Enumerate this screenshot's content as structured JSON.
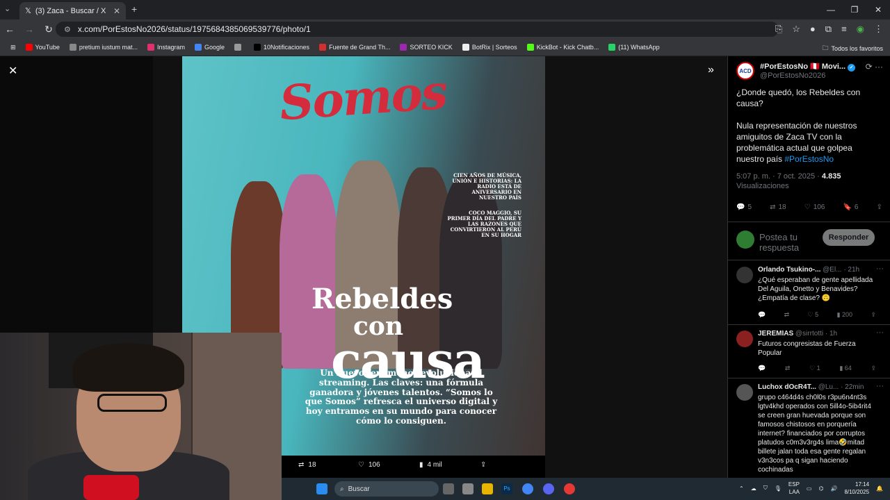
{
  "browser": {
    "tab_title": "(3) Zaca - Buscar / X",
    "url": "x.com/PorEstosNo2026/status/1975684385069539776/photo/1",
    "bookmarks": [
      {
        "label": "YouTube",
        "color": "#ff0000"
      },
      {
        "label": "pretium iustum mat...",
        "color": "#888888"
      },
      {
        "label": "Instagram",
        "color": "#e1306c"
      },
      {
        "label": "Google",
        "color": "#4285f4"
      },
      {
        "label": "",
        "color": "#999999"
      },
      {
        "label": "10Notificaciones",
        "color": "#000000"
      },
      {
        "label": "Fuente de Grand Th...",
        "color": "#d32f2f"
      },
      {
        "label": "SORTEO KICK",
        "color": "#9c27b0"
      },
      {
        "label": "BotRix | Sorteos",
        "color": "#eeeeee"
      },
      {
        "label": "KickBot - Kick Chatb...",
        "color": "#53fc18"
      },
      {
        "label": "(11) WhatsApp",
        "color": "#25d366"
      }
    ],
    "all_bookmarks": "Todos los favoritos"
  },
  "magazine": {
    "masthead": "Somos",
    "side_text_1": "Cien años de música, unión e historias: La radio está de aniversario en nuestro país",
    "side_text_2": "Coco Maggio, su primer día del padre y las razones que convirtieron al Perú en su hogar",
    "headline_1": "Rebeldes",
    "headline_2": "con",
    "headline_3": "causa",
    "description": "Un nuevo fenómeno revoluciona el streaming. Las claves: una fórmula ganadora y jóvenes talentos. “Somos lo que Somos” refresca el universo digital y hoy entramos en su mundo para conocer cómo lo consiguen."
  },
  "photo_actions": {
    "retweets": "18",
    "likes": "106",
    "views": "4 mil"
  },
  "tweet": {
    "author_name": "#PorEstosNo 🇵🇪 Movi...",
    "author_handle": "@PorEstosNo2026",
    "text_1": "¿Donde quedó, los Rebeldes con causa?",
    "text_2": "Nula representación de nuestros amiguitos de Zaca TV con la problemática actual que golpea nuestro país ",
    "hashtag": "#PorEstosNo",
    "time": "5:07 p. m. · 7 oct. 2025 · ",
    "views_count": "4.835",
    "views_label": "Visualizaciones",
    "replies": "5",
    "retweets": "18",
    "likes": "106",
    "bookmarks": "6",
    "reply_placeholder": "Postea tu respuesta",
    "reply_button": "Responder"
  },
  "replies": [
    {
      "name": "Orlando Tsukino-...",
      "handle": "@El...",
      "time": "· 21h",
      "text": "¿Qué esperaban de gente apellidada Del Aguila, Onetto y Benavides? ¿Empatía de clase? 🙃",
      "replies": "",
      "retweets": "",
      "likes": "5",
      "views": "200",
      "color": "#333333"
    },
    {
      "name": "JEREMÍAS",
      "handle": "@sirrtotti",
      "time": "· 1h",
      "text": "Futuros congresistas de Fuerza Popular",
      "replies": "",
      "retweets": "",
      "likes": "1",
      "views": "64",
      "color": "#8a2020"
    },
    {
      "name": "Luchox dOcR4T...",
      "handle": "@Lu...",
      "time": "· 22min",
      "text": "grupo c464d4s ch0l0s r3pu6n4nt3s lgtv4khd operados con 5ill4o-5ib4rit4 se creen gran huevada porque son famosos chistosos en porquería internet? financiados por corruptos platudos c0m3v3rg4s lima🤣mitad billete jalan toda esa gente regalan v3n3cos pa q sigan haciendo cochinadas",
      "color": "#555555"
    }
  ],
  "taskbar": {
    "search_placeholder": "Buscar",
    "lang_1": "ESP",
    "lang_2": "LAA",
    "time": "17:14",
    "date": "8/10/2025"
  }
}
